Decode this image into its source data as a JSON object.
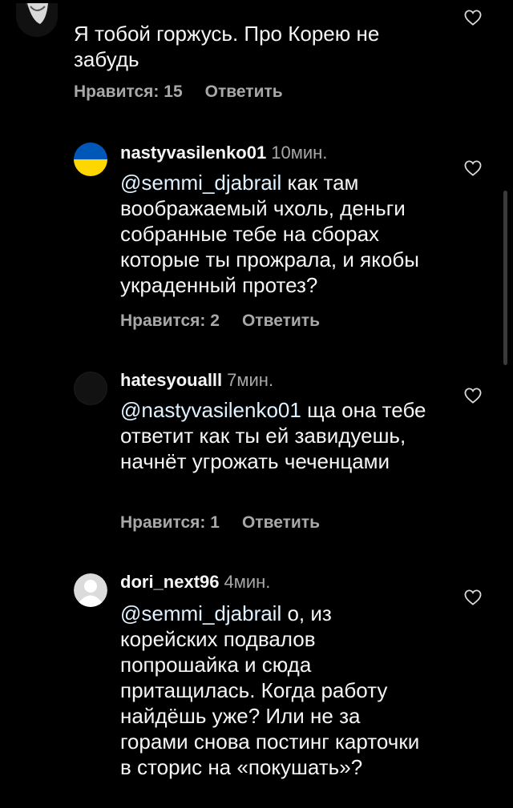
{
  "comments": [
    {
      "username": "",
      "time": "",
      "mention": "",
      "text": "Я тобой горжусь. Про Корею не забудь",
      "likes_label": "Нравится: 15",
      "reply_label": "Ответить"
    },
    {
      "username": "nastyvasilenko01",
      "time": "10мин.",
      "mention": "@semmi_djabrail",
      "text": " как там воображаемый чхоль, деньги собранные тебе на сборах которые ты прожрала, и якобы украденный протез?",
      "likes_label": "Нравится: 2",
      "reply_label": "Ответить"
    },
    {
      "username": "hatesyoualll",
      "time": "7мин.",
      "mention": "@nastyvasilenko01",
      "text": " ща она тебе ответит как ты ей завидуешь, начнёт угрожать чеченцами",
      "likes_label": "Нравится: 1",
      "reply_label": "Ответить"
    },
    {
      "username": "dori_next96",
      "time": "4мин.",
      "mention": "@semmi_djabrail",
      "text": " о, из корейских подвалов попрошайка и сюда притащилась. Когда работу найдёшь уже? Или не за горами снова постинг карточки в сторис на «покушать»?"
    }
  ],
  "icons": {
    "like": "heart-outline-icon"
  },
  "colors": {
    "background": "#000000",
    "text": "#f5f5f5",
    "secondary": "#a8a8a8",
    "mention": "#e0f1ff",
    "flag_blue": "#0057b7",
    "flag_yellow": "#ffd700"
  }
}
